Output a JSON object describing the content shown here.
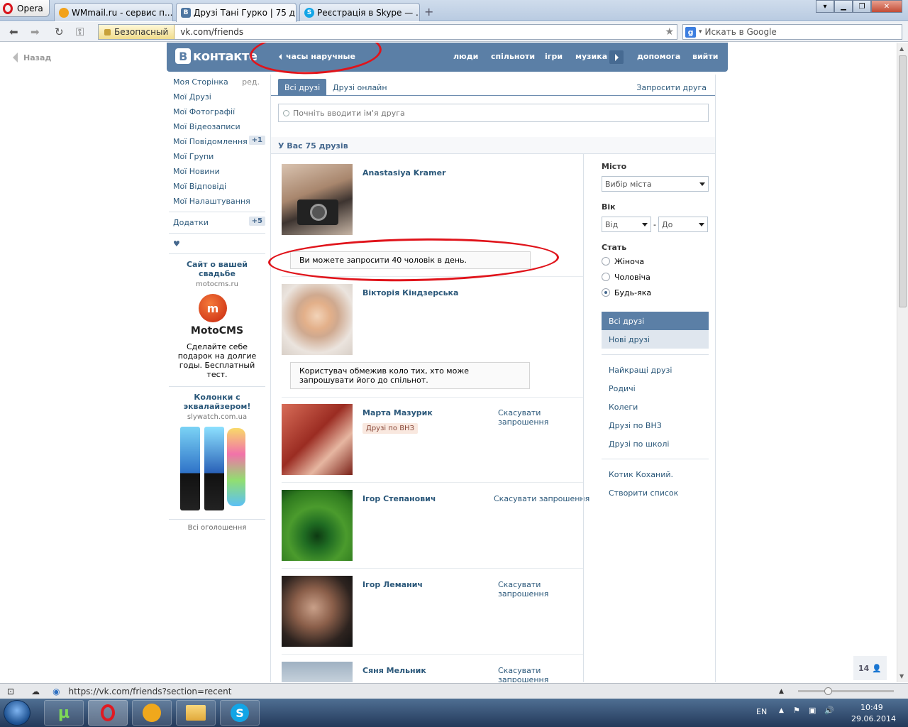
{
  "browser": {
    "opera_label": "Opera",
    "tabs": [
      {
        "title": "WMmail.ru - сервис п...",
        "color": "#f2a21b"
      },
      {
        "title": "Друзі Тані Гурко | 75 д...",
        "color": "#4d76a1"
      },
      {
        "title": "Реєстрація в Skype — ...",
        "color": "#12a5e6"
      }
    ],
    "security_label": "Безопасный",
    "url": "vk.com/friends",
    "search_placeholder": "Искать в Google",
    "status_url": "https://vk.com/friends?section=recent"
  },
  "page": {
    "back_label": "Назад",
    "logo_text": "контакте",
    "logo_letter": "В",
    "header_search": "часы наручные",
    "menu": [
      "люди",
      "спільноти",
      "ігри",
      "музика",
      "допомога",
      "вийти"
    ],
    "left_menu": {
      "my_page": "Моя Сторінка",
      "edit": "ред.",
      "friends": "Мої Друзі",
      "photos": "Мої Фотографії",
      "videos": "Мої Відеозаписи",
      "messages": "Мої Повідомлення",
      "messages_count": "+1",
      "groups": "Мої Групи",
      "news": "Мої Новини",
      "answers": "Мої Відповіді",
      "settings": "Мої Налаштування",
      "apps": "Додатки",
      "apps_count": "+5",
      "heart": "♥"
    },
    "ads": [
      {
        "title": "Сайт о вашей свадьбе",
        "domain": "motocms.ru",
        "brand": "MotoCMS",
        "text": "Сделайте себе подарок на долгие годы. Бесплатный тест."
      },
      {
        "title": "Колонки с эквалайзером!",
        "domain": "slywatch.com.ua"
      }
    ],
    "all_ads": "Всі оголошення",
    "tabs": {
      "all": "Всі друзі",
      "online": "Друзі онлайн",
      "invite": "Запросити друга"
    },
    "friend_search_placeholder": "Почніть вводити ім'я друга",
    "summary": "У Вас 75 друзів",
    "friends": [
      {
        "name": "Anastasiya Kramer",
        "action": "",
        "tag": ""
      },
      {
        "name": "Вікторія Кіндзерська",
        "action": "",
        "tag": ""
      },
      {
        "name": "Марта Мазурик",
        "action": "Скасувати запрошення",
        "tag": "Друзі по ВНЗ"
      },
      {
        "name": "Ігор Степанович",
        "action": "Скасувати запрошення",
        "tag": ""
      },
      {
        "name": "Ігор Леманич",
        "action": "Скасувати запрошення",
        "tag": ""
      },
      {
        "name": "Сяня Мельник",
        "action": "Скасувати запрошення",
        "tag": ""
      }
    ],
    "notice_1": "Ви можете запросити 40 чоловік в день.",
    "notice_2": "Користувач обмежив коло тих, хто може запрошувати його до спільнот.",
    "filters": {
      "city_label": "Місто",
      "city_value": "Вибір міста",
      "age_label": "Вік",
      "age_from": "Від",
      "age_dash": "-",
      "age_to": "До",
      "sex_label": "Стать",
      "sex_options": [
        "Жіноча",
        "Чоловіча",
        "Будь-яка"
      ],
      "sex_selected": "Будь-яка"
    },
    "right_nav": {
      "all": "Всі друзі",
      "new": "Нові друзі",
      "best": "Найкращі друзі",
      "relatives": "Родичі",
      "colleagues": "Колеги",
      "university": "Друзі по ВНЗ",
      "school": "Друзі по школі",
      "list1": "Котик Коханий.",
      "create": "Створити список"
    },
    "online_count": "14"
  },
  "taskbar": {
    "lang": "EN",
    "time": "10:49",
    "date": "29.06.2014"
  }
}
